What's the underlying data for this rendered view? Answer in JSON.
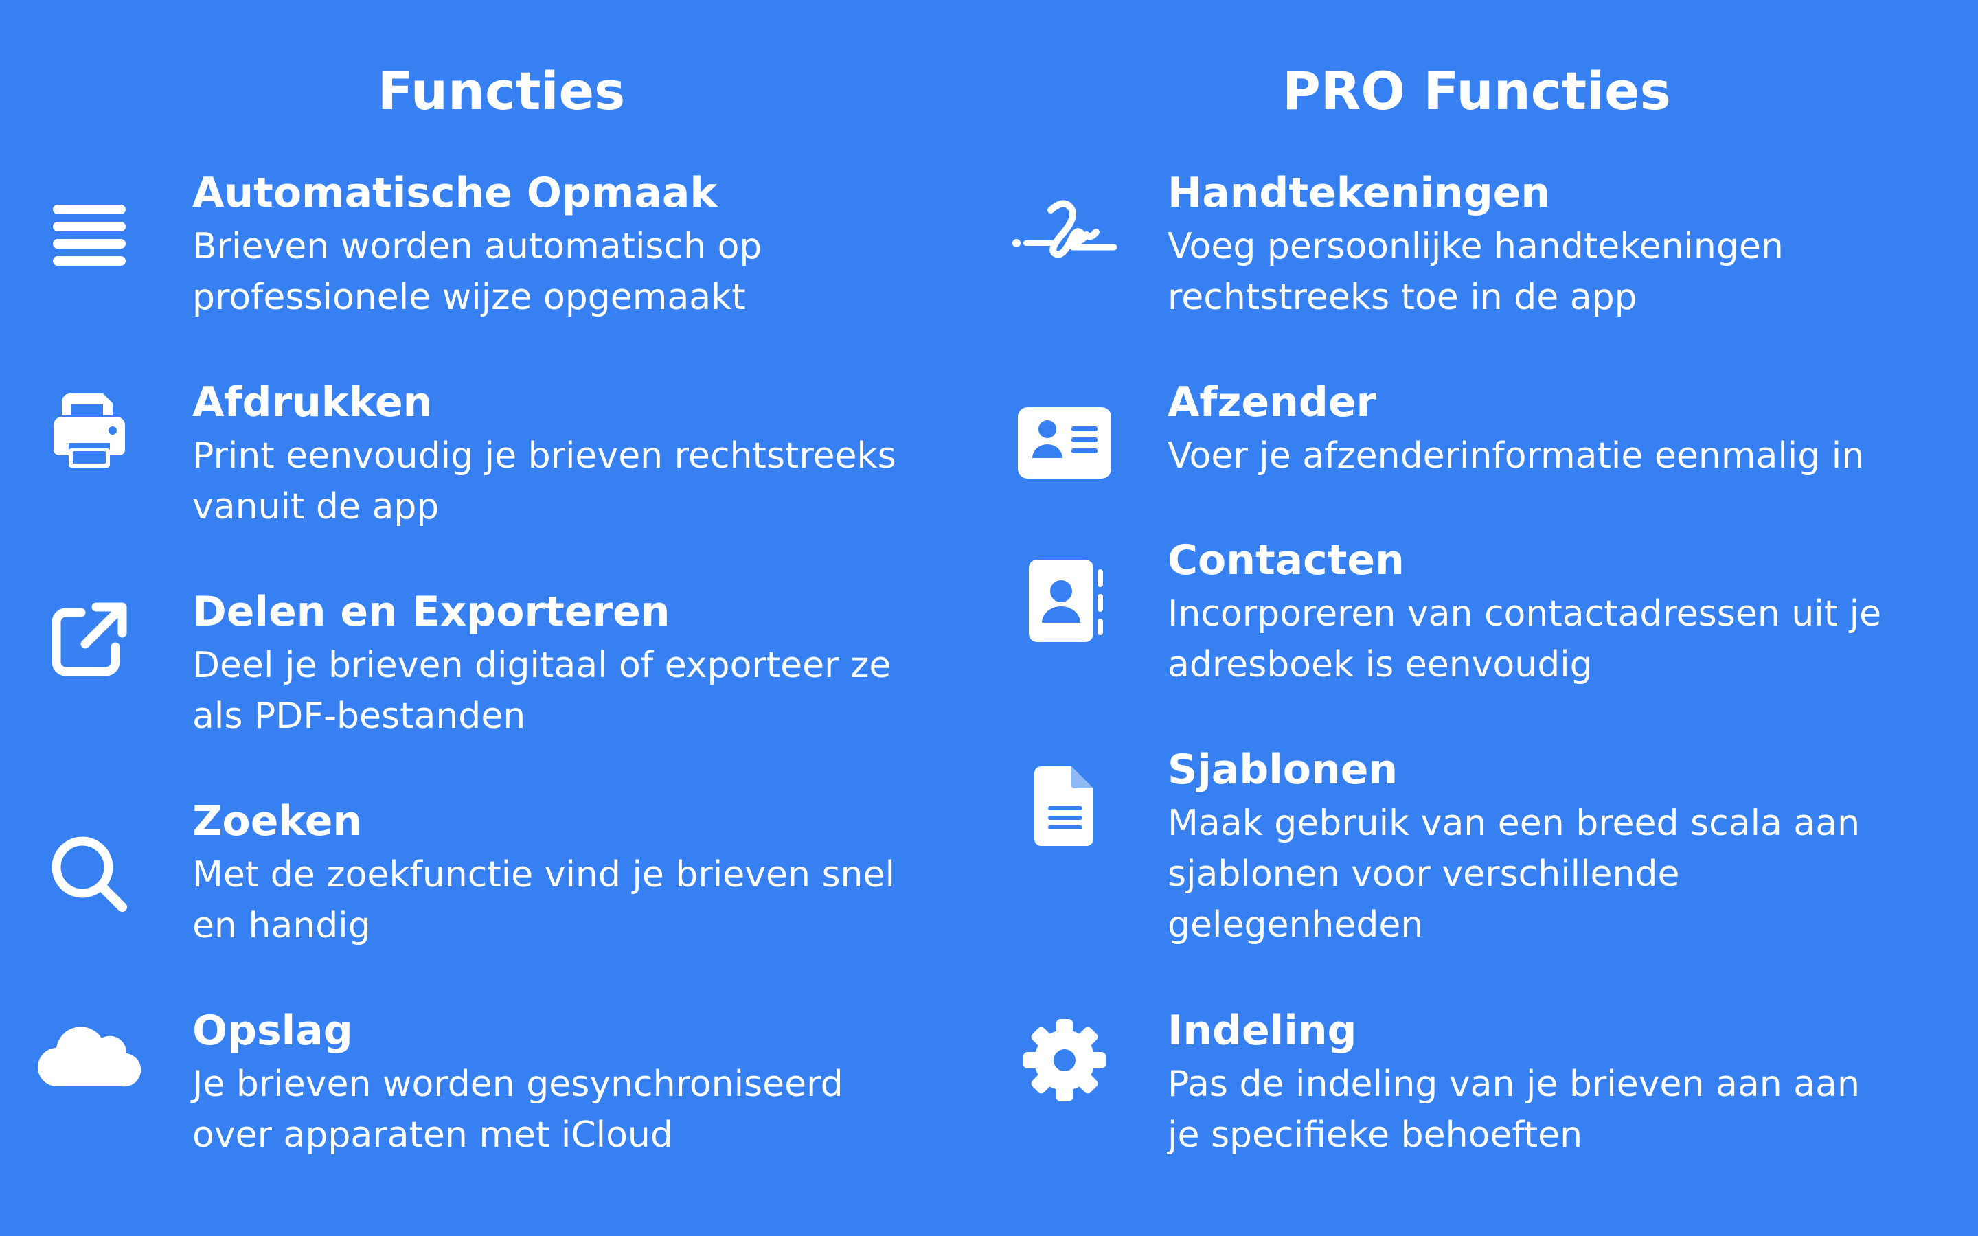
{
  "columns": {
    "left": {
      "title": "Functies",
      "features": [
        {
          "icon": "lines-icon",
          "title": "Automatische Opmaak",
          "desc": "Brieven worden automatisch op\nprofessionele wijze opgemaakt"
        },
        {
          "icon": "printer-icon",
          "title": "Afdrukken",
          "desc": "Print eenvoudig je brieven rechtstreeks\nvanuit de app"
        },
        {
          "icon": "share-export-icon",
          "title": "Delen en Exporteren",
          "desc": "Deel je brieven digitaal of exporteer ze\nals PDF-bestanden"
        },
        {
          "icon": "search-icon",
          "title": "Zoeken",
          "desc": "Met de zoekfunctie vind je brieven snel\nen handig"
        },
        {
          "icon": "cloud-icon",
          "title": "Opslag",
          "desc": "Je brieven worden gesynchroniseerd\nover apparaten met iCloud"
        }
      ]
    },
    "right": {
      "title": "PRO Functies",
      "features": [
        {
          "icon": "signature-icon",
          "title": "Handtekeningen",
          "desc": "Voeg persoonlijke handtekeningen\nrechtstreeks toe in de app"
        },
        {
          "icon": "id-card-icon",
          "title": "Afzender",
          "desc": "Voer je afzenderinformatie eenmalig in"
        },
        {
          "icon": "address-book-icon",
          "title": "Contacten",
          "desc": "Incorporeren van contactadressen uit je\nadresboek is eenvoudig"
        },
        {
          "icon": "document-icon",
          "title": "Sjablonen",
          "desc": "Maak gebruik van een breed scala aan\nsjablonen voor verschillende\ngelegenheden"
        },
        {
          "icon": "gear-icon",
          "title": "Indeling",
          "desc": "Pas de indeling van je brieven aan aan\nje specifieke behoeften"
        }
      ]
    }
  },
  "colors": {
    "background": "#3780f1",
    "foreground": "#ffffff"
  }
}
